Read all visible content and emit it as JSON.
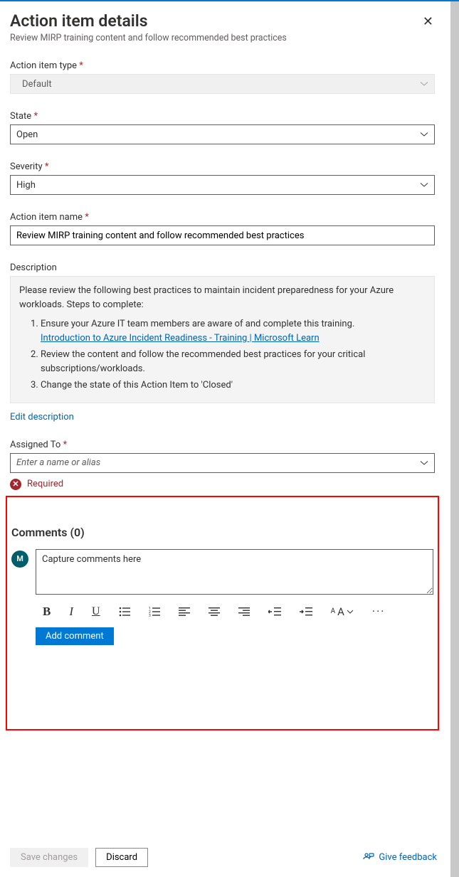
{
  "header": {
    "title": "Action item details",
    "subtitle": "Review MIRP training content and follow recommended best practices"
  },
  "fields": {
    "type": {
      "label": "Action item type",
      "required": true,
      "value": "Default"
    },
    "state": {
      "label": "State",
      "required": true,
      "value": "Open"
    },
    "severity": {
      "label": "Severity",
      "required": true,
      "value": "High"
    },
    "name": {
      "label": "Action item name",
      "required": true,
      "value": "Review MIRP training content and follow recommended best practices"
    },
    "description": {
      "label": "Description",
      "intro": "Please review the following best practices to maintain incident preparedness for your Azure workloads. Steps to complete:",
      "steps": [
        {
          "text": "Ensure your Azure IT team members are aware of and complete this training.",
          "link_text": "Introduction to Azure Incident Readiness - Training | Microsoft Learn"
        },
        {
          "text": "Review the content and follow the recommended best practices for your critical subscriptions/workloads."
        },
        {
          "text": "Change the state of this Action Item to 'Closed'"
        }
      ],
      "edit_label": "Edit description"
    },
    "assigned": {
      "label": "Assigned To",
      "required": true,
      "placeholder": "Enter a name or alias",
      "error": "Required"
    }
  },
  "comments": {
    "title": "Comments (0)",
    "avatar_initial": "M",
    "placeholder": "Capture comments here",
    "add_button": "Add comment"
  },
  "footer": {
    "save": "Save changes",
    "discard": "Discard",
    "feedback": "Give feedback"
  }
}
